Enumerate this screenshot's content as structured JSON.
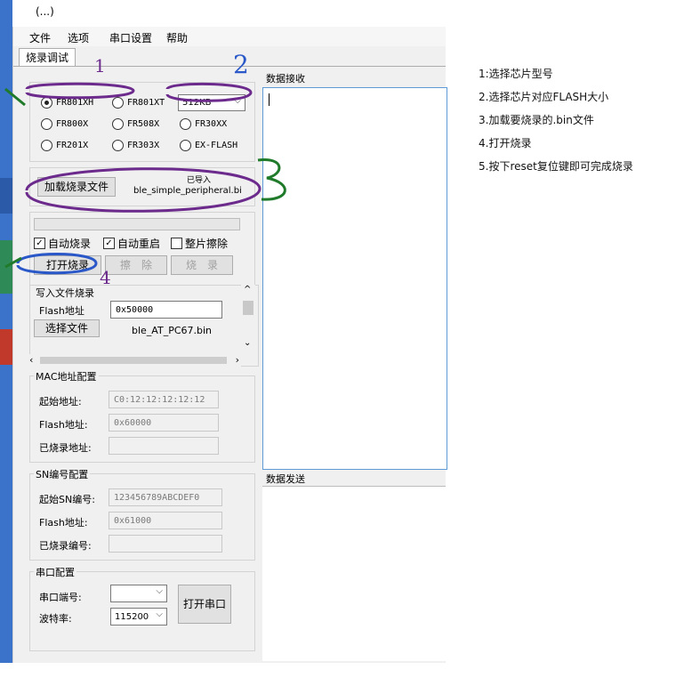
{
  "window_title": "(...)",
  "menu": [
    "文件",
    "选项",
    "串口设置",
    "帮助"
  ],
  "tab": "烧录调试",
  "chip_select": {
    "options": [
      "FR801XH",
      "FR801XT",
      "FR800X",
      "FR508X",
      "FR30XX",
      "FR201X",
      "FR303X",
      "EX-FLASH"
    ],
    "selected": "FR801XH",
    "flash_size": "512KB"
  },
  "load_file": {
    "button": "加载烧录文件",
    "status": "已导入",
    "filename": "ble_simple_peripheral.bi"
  },
  "burn_options": {
    "auto_burn": "自动烧录",
    "auto_restart": "自动重启",
    "chip_erase": "整片擦除",
    "open_burn_button": "打开烧录",
    "erase_button": "擦　除",
    "burn_button": "烧　录"
  },
  "write_file": {
    "group_label": "写入文件烧录",
    "flash_addr_label": "Flash地址",
    "flash_addr_value": "0x50000",
    "select_button": "选择文件",
    "filename": "ble_AT_PC67.bin"
  },
  "mac_config": {
    "group_label": "MAC地址配置",
    "start_label": "起始地址:",
    "start_value": "C0:12:12:12:12:12",
    "flash_label": "Flash地址:",
    "flash_value": "0x60000",
    "burned_label": "已烧录地址:",
    "burned_value": ""
  },
  "sn_config": {
    "group_label": "SN编号配置",
    "start_label": "起始SN编号:",
    "start_value": "123456789ABCDEF0",
    "flash_label": "Flash地址:",
    "flash_value": "0x61000",
    "burned_label": "已烧录编号:",
    "burned_value": ""
  },
  "serial_config": {
    "group_label": "串口配置",
    "port_label": "串口端号:",
    "port_value": "",
    "baud_label": "波特率:",
    "baud_value": "115200",
    "open_button": "打开串口"
  },
  "receive_label": "数据接收",
  "send_label": "数据发送",
  "notes": [
    "1:选择芯片型号",
    "2.选择芯片对应FLASH大小",
    "3.加载要烧录的.bin文件",
    "4.打开烧录",
    "5.按下reset复位键即可完成烧录"
  ],
  "annotations": [
    "1",
    "2",
    "3",
    "4"
  ],
  "colors": {
    "accent_blue": "#5e9ad6",
    "annot_green": "#1f7a2a",
    "annot_purple": "#6b2a8c",
    "annot_blue": "#2a58c8",
    "taskbar_blue": "#3a73c9"
  }
}
